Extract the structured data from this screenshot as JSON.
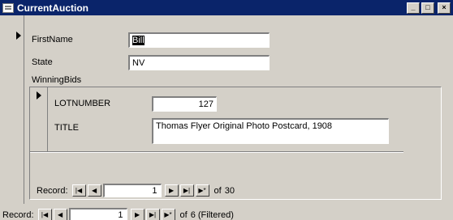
{
  "window": {
    "title": "CurrentAuction"
  },
  "icons": {
    "app": "form-icon",
    "minimize": "minimize-icon",
    "maximize": "maximize-icon",
    "close": "close-icon",
    "first": "first-record-icon",
    "prev": "previous-record-icon",
    "next": "next-record-icon",
    "last": "last-record-icon",
    "new": "new-record-icon",
    "selector": "record-selector-arrow-icon"
  },
  "main_form": {
    "first_name_label": "FirstName",
    "first_name_value": "Bill",
    "state_label": "State",
    "state_value": "NV",
    "subform_label": "WinningBids"
  },
  "subform": {
    "lot_number_label": "LOTNUMBER",
    "lot_number_value": "127",
    "title_label": "TITLE",
    "title_value": "Thomas Flyer Original Photo Postcard, 1908",
    "nav": {
      "label": "Record:",
      "current": "1",
      "of": "of",
      "total": "30"
    }
  },
  "main_nav": {
    "label": "Record:",
    "current": "1",
    "of": "of",
    "total": "6 (Filtered)"
  }
}
